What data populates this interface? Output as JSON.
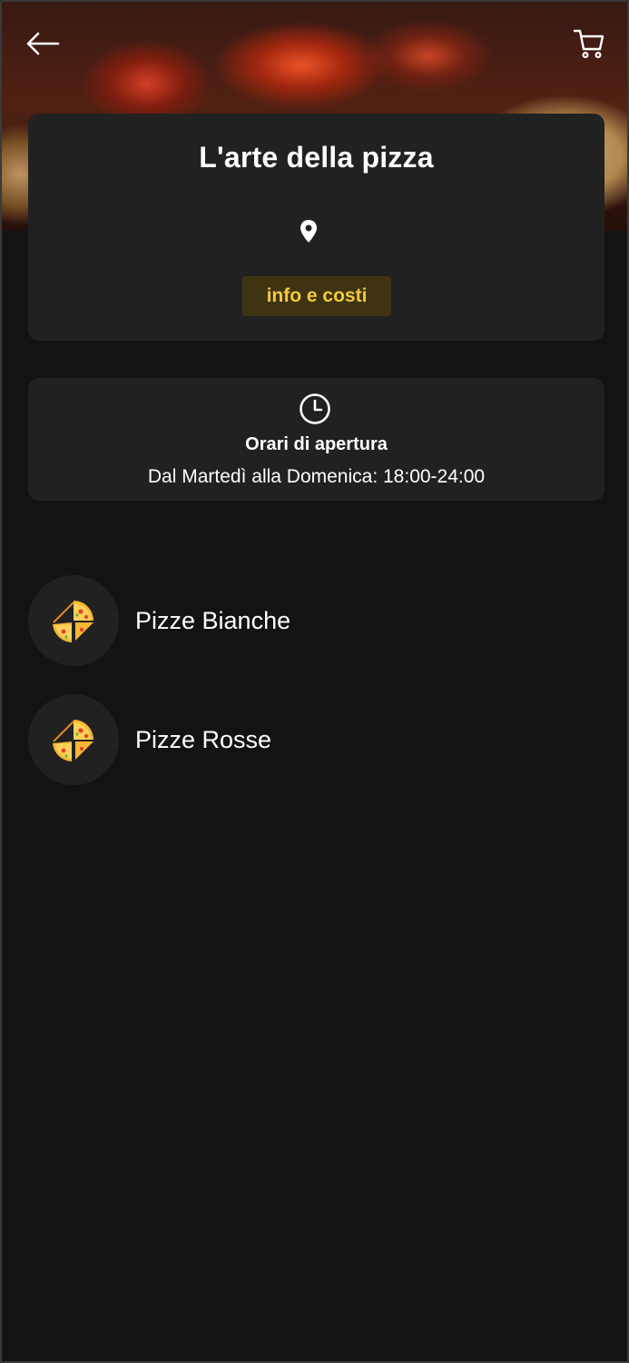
{
  "restaurant": {
    "name": "L'arte della pizza",
    "info_button_label": "info e costi"
  },
  "hours": {
    "title": "Orari di apertura",
    "text": "Dal Martedì alla Domenica: 18:00-24:00"
  },
  "categories": [
    {
      "label": "Pizze Bianche",
      "icon": "pizza-slice-icon"
    },
    {
      "label": "Pizze Rosse",
      "icon": "pizza-slice-icon"
    }
  ],
  "colors": {
    "background": "#131313",
    "card": "#212121",
    "accent": "#f4c93a",
    "accent_bg": "#3f3412"
  }
}
